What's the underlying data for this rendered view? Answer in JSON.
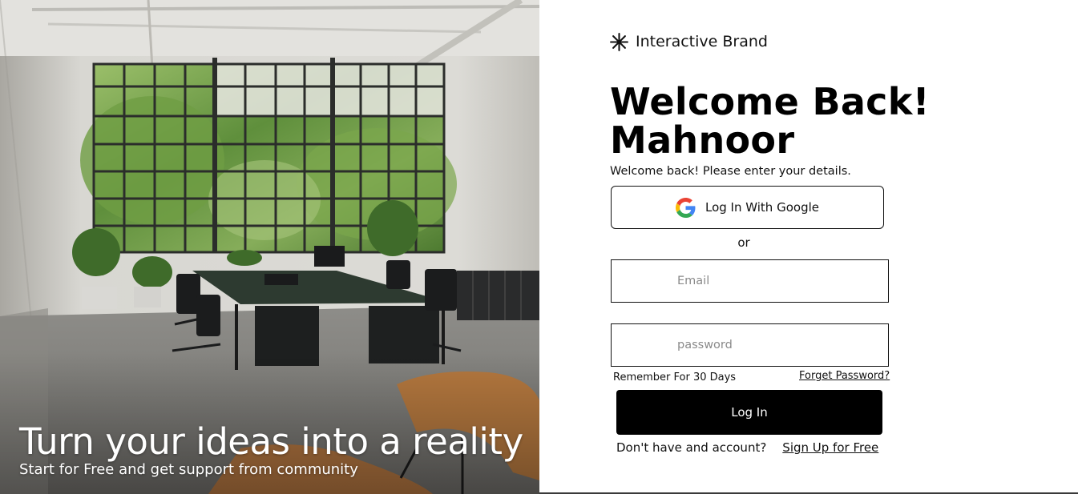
{
  "hero": {
    "title": "Turn your ideas into a reality",
    "subtitle": "Start for Free and get support from community"
  },
  "brand": {
    "name": "Interactive Brand",
    "icon": "asterisk-icon"
  },
  "welcome": {
    "line1": "Welcome Back!",
    "line2": "Mahnoor",
    "subtitle": "Welcome back! Please enter your details."
  },
  "google_button": {
    "label": "Log In With Google",
    "icon": "google-icon"
  },
  "divider_text": "or",
  "email_field": {
    "placeholder": "Email",
    "value": ""
  },
  "password_field": {
    "placeholder": "password",
    "value": ""
  },
  "remember_label": "Remember For 30 Days",
  "forgot_link": "Forget Password?",
  "login_button": {
    "label": "Log In"
  },
  "signup": {
    "prompt": "Don't have and account?",
    "link": "Sign Up for Free"
  },
  "colors": {
    "primary_button": "#000000",
    "primary_button_text": "#ffffff",
    "border": "#111111",
    "google_blue": "#4285F4",
    "google_red": "#EA4335",
    "google_yellow": "#FBBC05",
    "google_green": "#34A853"
  }
}
